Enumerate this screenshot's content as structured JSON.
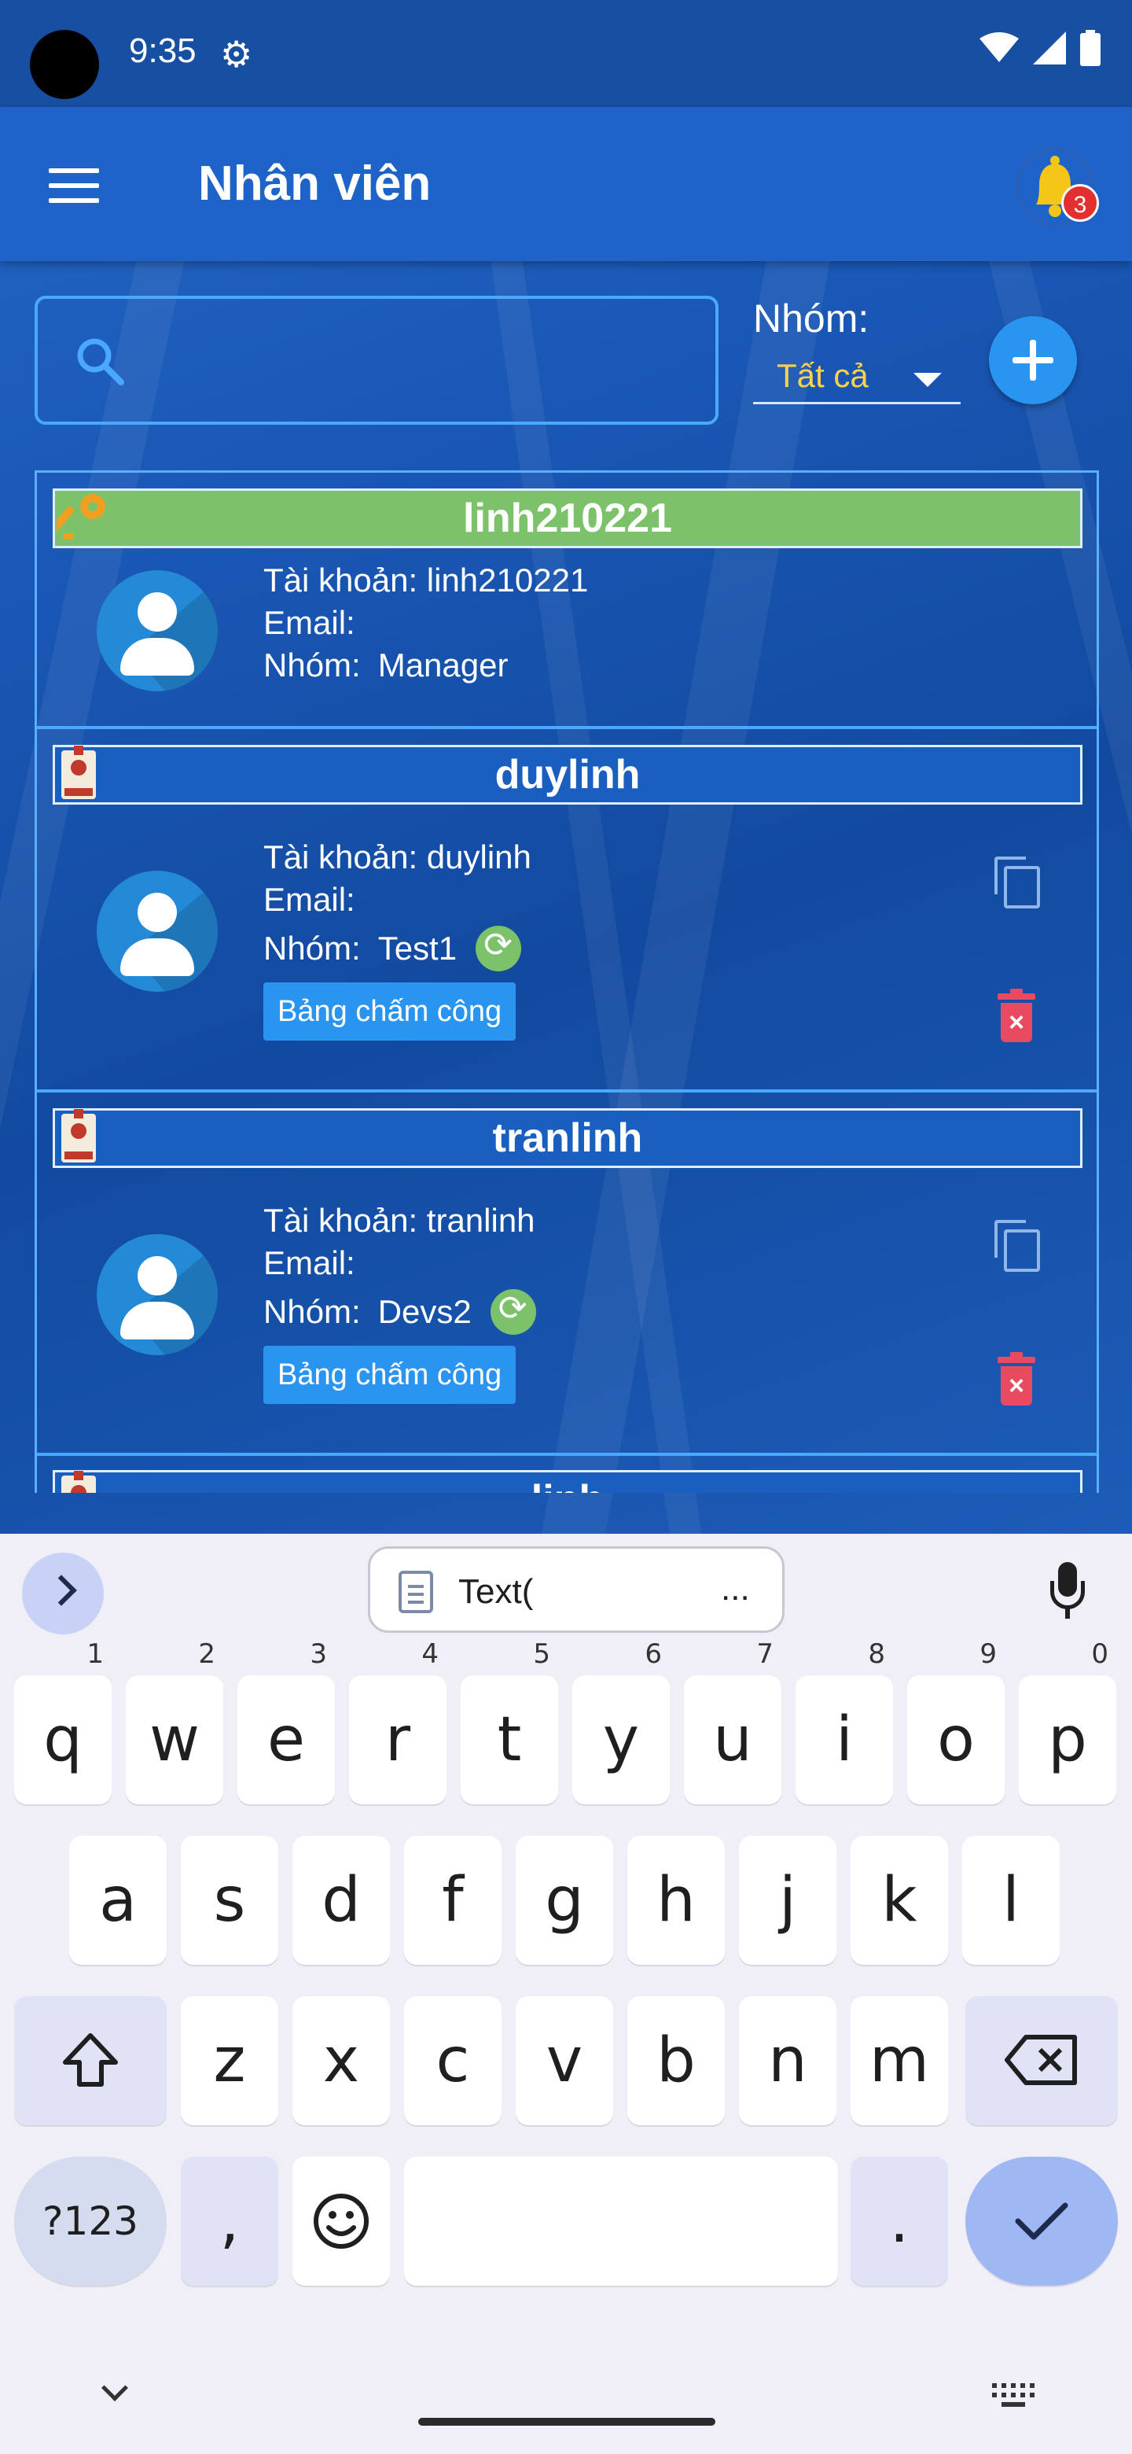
{
  "status_bar": {
    "time": "9:35"
  },
  "app_bar": {
    "title": "Nhân viên",
    "notification_count": "3"
  },
  "search": {
    "value": "",
    "placeholder": ""
  },
  "group_filter": {
    "label": "Nhóm:",
    "selected": "Tất cả"
  },
  "employees": [
    {
      "username": "linh210221",
      "account_line": "Tài khoản: linh210221",
      "email_line": "Email:",
      "group_prefix": "Nhóm:",
      "group": "Manager",
      "role": "manager"
    },
    {
      "username": "duylinh",
      "account_line": "Tài khoản: duylinh",
      "email_line": "Email:",
      "group_prefix": "Nhóm:",
      "group": "Test1",
      "role": "staff",
      "timesheet_label": "Bảng chấm công"
    },
    {
      "username": "tranlinh",
      "account_line": "Tài khoản: tranlinh",
      "email_line": "Email:",
      "group_prefix": "Nhóm:",
      "group": "Devs2",
      "role": "staff",
      "timesheet_label": "Bảng chấm công"
    },
    {
      "username": "linh",
      "role": "staff"
    }
  ],
  "keyboard": {
    "clipboard_text": "Text(",
    "clipboard_more": "...",
    "row1": [
      [
        "q",
        "1"
      ],
      [
        "w",
        "2"
      ],
      [
        "e",
        "3"
      ],
      [
        "r",
        "4"
      ],
      [
        "t",
        "5"
      ],
      [
        "y",
        "6"
      ],
      [
        "u",
        "7"
      ],
      [
        "i",
        "8"
      ],
      [
        "o",
        "9"
      ],
      [
        "p",
        "0"
      ]
    ],
    "row2": [
      "a",
      "s",
      "d",
      "f",
      "g",
      "h",
      "j",
      "k",
      "l"
    ],
    "row3": [
      "z",
      "x",
      "c",
      "v",
      "b",
      "n",
      "m"
    ],
    "num_key": "?123",
    "comma": ",",
    "period": "."
  },
  "colors": {
    "app_bar": "#1e63c8",
    "manager_header": "#7cc26a",
    "staff_header": "#1a5fbf",
    "delete": "#e84a5f",
    "accent": "#2a95f0"
  }
}
